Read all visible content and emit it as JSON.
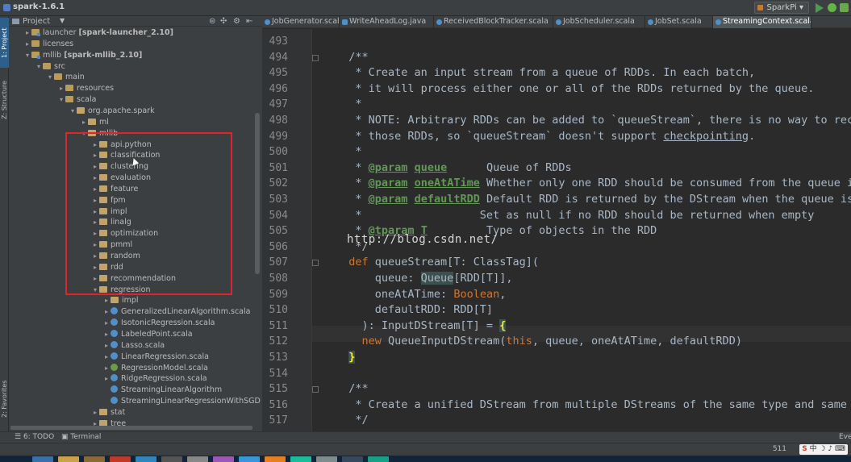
{
  "window": {
    "title": "spark-1.6.1"
  },
  "toolbar": {
    "run_config": "SparkPi"
  },
  "side_tabs": {
    "project": "1: Project",
    "structure": "Z: Structure",
    "favorites": "2: Favorites"
  },
  "project_panel": {
    "label": "Project",
    "dropdown_arrow": "▼"
  },
  "tree": [
    {
      "label": "launcher",
      "module": "[spark-launcher_2.10]",
      "depth": 1,
      "arrow": "▸",
      "icon": "module"
    },
    {
      "label": "licenses",
      "depth": 1,
      "arrow": "▸",
      "icon": "folder"
    },
    {
      "label": "mllib",
      "module": "[spark-mllib_2.10]",
      "depth": 1,
      "arrow": "▾",
      "icon": "module"
    },
    {
      "label": "src",
      "depth": 2,
      "arrow": "▾",
      "icon": "folder"
    },
    {
      "label": "main",
      "depth": 3,
      "arrow": "▾",
      "icon": "folder"
    },
    {
      "label": "resources",
      "depth": 4,
      "arrow": "▸",
      "icon": "folder"
    },
    {
      "label": "scala",
      "depth": 4,
      "arrow": "▾",
      "icon": "folder"
    },
    {
      "label": "org.apache.spark",
      "depth": 5,
      "arrow": "▾",
      "icon": "package"
    },
    {
      "label": "ml",
      "depth": 6,
      "arrow": "▸",
      "icon": "package"
    },
    {
      "label": "mllib",
      "depth": 6,
      "arrow": "▾",
      "icon": "package"
    },
    {
      "label": "api.python",
      "depth": 7,
      "arrow": "▸",
      "icon": "package"
    },
    {
      "label": "classification",
      "depth": 7,
      "arrow": "▸",
      "icon": "package"
    },
    {
      "label": "clustering",
      "depth": 7,
      "arrow": "▸",
      "icon": "package"
    },
    {
      "label": "evaluation",
      "depth": 7,
      "arrow": "▸",
      "icon": "package"
    },
    {
      "label": "feature",
      "depth": 7,
      "arrow": "▸",
      "icon": "package"
    },
    {
      "label": "fpm",
      "depth": 7,
      "arrow": "▸",
      "icon": "package"
    },
    {
      "label": "impl",
      "depth": 7,
      "arrow": "▸",
      "icon": "package"
    },
    {
      "label": "linalg",
      "depth": 7,
      "arrow": "▸",
      "icon": "package"
    },
    {
      "label": "optimization",
      "depth": 7,
      "arrow": "▸",
      "icon": "package"
    },
    {
      "label": "pmml",
      "depth": 7,
      "arrow": "▸",
      "icon": "package"
    },
    {
      "label": "random",
      "depth": 7,
      "arrow": "▸",
      "icon": "package"
    },
    {
      "label": "rdd",
      "depth": 7,
      "arrow": "▸",
      "icon": "package"
    },
    {
      "label": "recommendation",
      "depth": 7,
      "arrow": "▸",
      "icon": "package"
    },
    {
      "label": "regression",
      "depth": 7,
      "arrow": "▾",
      "icon": "package"
    },
    {
      "label": "impl",
      "depth": 8,
      "arrow": "▸",
      "icon": "package"
    },
    {
      "label": "GeneralizedLinearAlgorithm.scala",
      "depth": 8,
      "arrow": "▸",
      "icon": "scala"
    },
    {
      "label": "IsotonicRegression.scala",
      "depth": 8,
      "arrow": "▸",
      "icon": "scala"
    },
    {
      "label": "LabeledPoint.scala",
      "depth": 8,
      "arrow": "▸",
      "icon": "scala"
    },
    {
      "label": "Lasso.scala",
      "depth": 8,
      "arrow": "▸",
      "icon": "scala"
    },
    {
      "label": "LinearRegression.scala",
      "depth": 8,
      "arrow": "▸",
      "icon": "scala"
    },
    {
      "label": "RegressionModel.scala",
      "depth": 8,
      "arrow": "▸",
      "icon": "object"
    },
    {
      "label": "RidgeRegression.scala",
      "depth": 8,
      "arrow": "▸",
      "icon": "scala"
    },
    {
      "label": "StreamingLinearAlgorithm",
      "depth": 8,
      "arrow": "",
      "icon": "scala"
    },
    {
      "label": "StreamingLinearRegressionWithSGD",
      "depth": 8,
      "arrow": "",
      "icon": "scala"
    },
    {
      "label": "stat",
      "depth": 7,
      "arrow": "▸",
      "icon": "package"
    },
    {
      "label": "tree",
      "depth": 7,
      "arrow": "▸",
      "icon": "package"
    }
  ],
  "editor_tabs": [
    {
      "label": "JobGenerator.scala",
      "icon": "scala",
      "active": false
    },
    {
      "label": "WriteAheadLog.java",
      "icon": "java",
      "active": false
    },
    {
      "label": "ReceivedBlockTracker.scala",
      "icon": "scala",
      "active": false
    },
    {
      "label": "JobScheduler.scala",
      "icon": "scala",
      "active": false
    },
    {
      "label": "JobSet.scala",
      "icon": "scala",
      "active": false
    },
    {
      "label": "StreamingContext.scala",
      "icon": "scala",
      "active": true
    }
  ],
  "code_lines": [
    {
      "n": "493",
      "parts": []
    },
    {
      "n": "494",
      "parts": [
        {
          "t": "  /**",
          "c": "cmt"
        }
      ]
    },
    {
      "n": "495",
      "parts": [
        {
          "t": "   * Create an input stream from a queue of RDDs. In each batch,",
          "c": "cmt"
        }
      ]
    },
    {
      "n": "496",
      "parts": [
        {
          "t": "   * it will process either one or all of the RDDs returned by the queue.",
          "c": "cmt"
        }
      ]
    },
    {
      "n": "497",
      "parts": [
        {
          "t": "   *",
          "c": "cmt"
        }
      ]
    },
    {
      "n": "498",
      "parts": [
        {
          "t": "   * NOTE: Arbitrary RDDs can be added to `queueStream`, there is no way to recover data of",
          "c": "cmt"
        }
      ]
    },
    {
      "n": "499",
      "parts": [
        {
          "t": "   * those RDDs, so `queueStream` doesn't support ",
          "c": "cmt"
        },
        {
          "t": "checkpointing",
          "c": "cmt und"
        },
        {
          "t": ".",
          "c": "cmt"
        }
      ]
    },
    {
      "n": "500",
      "parts": [
        {
          "t": "   *",
          "c": "cmt"
        }
      ]
    },
    {
      "n": "501",
      "parts": [
        {
          "t": "   * ",
          "c": "cmt"
        },
        {
          "t": "@param",
          "c": "tag"
        },
        {
          "t": " ",
          "c": "cmt"
        },
        {
          "t": "queue",
          "c": "tag"
        },
        {
          "t": "      Queue of RDDs",
          "c": "cmt"
        }
      ]
    },
    {
      "n": "502",
      "parts": [
        {
          "t": "   * ",
          "c": "cmt"
        },
        {
          "t": "@param",
          "c": "tag"
        },
        {
          "t": " ",
          "c": "cmt"
        },
        {
          "t": "oneAtATime",
          "c": "tag"
        },
        {
          "t": " Whether only one RDD should be consumed from the queue in every interval",
          "c": "cmt"
        }
      ]
    },
    {
      "n": "503",
      "parts": [
        {
          "t": "   * ",
          "c": "cmt"
        },
        {
          "t": "@param",
          "c": "tag"
        },
        {
          "t": " ",
          "c": "cmt"
        },
        {
          "t": "defaultRDD",
          "c": "tag"
        },
        {
          "t": " Default RDD is returned by the DStream when the queue is empty.",
          "c": "cmt"
        }
      ]
    },
    {
      "n": "504",
      "parts": [
        {
          "t": "   *                  Set as null if no RDD should be returned when empty",
          "c": "cmt"
        }
      ]
    },
    {
      "n": "505",
      "parts": [
        {
          "t": "   * ",
          "c": "cmt"
        },
        {
          "t": "@tparam",
          "c": "tag"
        },
        {
          "t": " ",
          "c": "cmt"
        },
        {
          "t": "T",
          "c": "tag"
        },
        {
          "t": "         Type of objects in the RDD",
          "c": "cmt"
        }
      ]
    },
    {
      "n": "506",
      "parts": [
        {
          "t": "   */",
          "c": "cmt"
        }
      ]
    },
    {
      "n": "507",
      "parts": [
        {
          "t": "  def ",
          "c": "kw"
        },
        {
          "t": "queueStream[T: ClassTag](",
          "c": "ty"
        }
      ]
    },
    {
      "n": "508",
      "parts": [
        {
          "t": "      queue: ",
          "c": "ty"
        },
        {
          "t": "Queue",
          "c": "hl"
        },
        {
          "t": "[RDD[T]],",
          "c": "ty"
        }
      ]
    },
    {
      "n": "509",
      "parts": [
        {
          "t": "      oneAtATime: ",
          "c": "ty"
        },
        {
          "t": "Boolean",
          "c": "kw"
        },
        {
          "t": ",",
          "c": "ty"
        }
      ]
    },
    {
      "n": "510",
      "parts": [
        {
          "t": "      defaultRDD: RDD[T]",
          "c": "ty"
        }
      ]
    },
    {
      "n": "511",
      "parts": [
        {
          "t": "    ): InputDStream[T] = ",
          "c": "ty"
        },
        {
          "t": "{",
          "c": "br"
        }
      ]
    },
    {
      "n": "512",
      "parts": [
        {
          "t": "    ",
          "c": "ty"
        },
        {
          "t": "new ",
          "c": "kw"
        },
        {
          "t": "QueueInputDStream(",
          "c": "ty"
        },
        {
          "t": "this",
          "c": "kw"
        },
        {
          "t": ", queue, oneAtATime, defaultRDD)",
          "c": "ty"
        }
      ]
    },
    {
      "n": "513",
      "parts": [
        {
          "t": "  ",
          "c": "ty"
        },
        {
          "t": "}",
          "c": "br"
        }
      ]
    },
    {
      "n": "514",
      "parts": []
    },
    {
      "n": "515",
      "parts": [
        {
          "t": "  /**",
          "c": "cmt"
        }
      ]
    },
    {
      "n": "516",
      "parts": [
        {
          "t": "   * Create a unified DStream from multiple DStreams of the same type and same slide duration.",
          "c": "cmt"
        }
      ]
    },
    {
      "n": "517",
      "parts": [
        {
          "t": "   */",
          "c": "cmt"
        }
      ]
    }
  ],
  "watermark": "http://blog.csdn.net/",
  "bottom_tools": {
    "todo": "6: TODO",
    "terminal": "Terminal",
    "event": "Eve"
  },
  "status": {
    "position": "511",
    "ime": "中"
  },
  "colors": {
    "highlight_box": "#e0242b",
    "comment": "#629755",
    "keyword": "#cc7832",
    "background": "#2b2b2b"
  }
}
